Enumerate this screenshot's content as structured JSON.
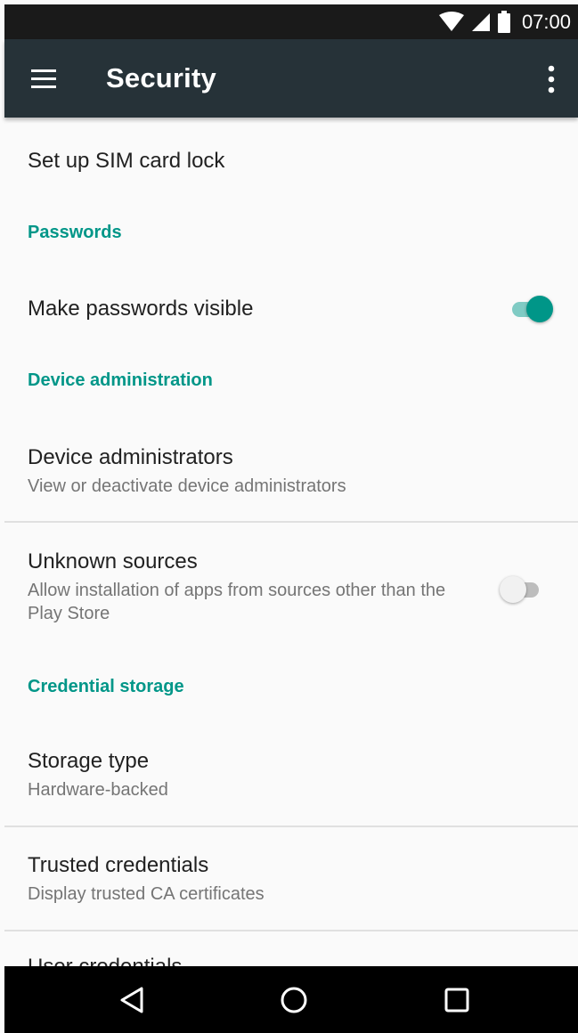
{
  "status_bar": {
    "time": "07:00",
    "icons": [
      "wifi-icon",
      "cell-signal-icon",
      "battery-icon"
    ]
  },
  "app_bar": {
    "title": "Security",
    "left_icon": "menu-icon",
    "right_icon": "overflow-menu-icon",
    "background": "#263238"
  },
  "settings": {
    "sim_lock": {
      "title": "Set up SIM card lock"
    },
    "passwords_category": "Passwords",
    "make_passwords_visible": {
      "title": "Make passwords visible",
      "enabled": true
    },
    "device_admin_category": "Device administration",
    "device_administrators": {
      "title": "Device administrators",
      "summary": "View or deactivate device administrators"
    },
    "unknown_sources": {
      "title": "Unknown sources",
      "summary": "Allow installation of apps from sources other than the Play Store",
      "enabled": false
    },
    "credential_storage_category": "Credential storage",
    "storage_type": {
      "title": "Storage type",
      "summary": "Hardware-backed"
    },
    "trusted_credentials": {
      "title": "Trusted credentials",
      "summary": "Display trusted CA certificates"
    },
    "user_credentials": {
      "title": "User credentials"
    }
  },
  "nav_bar": {
    "buttons": [
      "back-icon",
      "home-icon",
      "recents-icon"
    ]
  },
  "colors": {
    "accent": "#009688",
    "accent_light": "#80cbc4",
    "divider": "#e0e0e0",
    "primary_text": "#212121",
    "secondary_text": "#757575"
  }
}
